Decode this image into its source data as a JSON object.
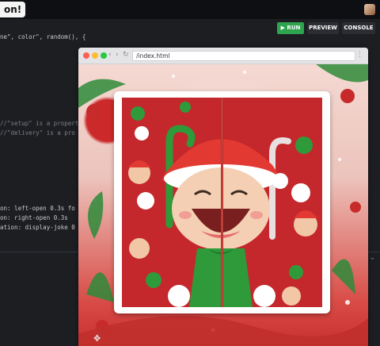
{
  "topbar": {
    "title_fragment": "on!"
  },
  "toolbar": {
    "run_label": "▶ RUN",
    "preview_label": "PREVIEW",
    "console_label": "CONSOLE"
  },
  "code_lines": [
    "ne\", color\", random(), {",
    "//\"setup\" is a propert",
    "//\"delivery\" is a pro",
    "on: left-open 0.3s fo",
    "on: right-open 0.3s",
    "ation: display-joke 0"
  ],
  "browser": {
    "url": "/index.html"
  },
  "colors": {
    "run": "#2ea44f",
    "card_bg": "#c4272c",
    "accent_green": "#2f9a3a"
  }
}
